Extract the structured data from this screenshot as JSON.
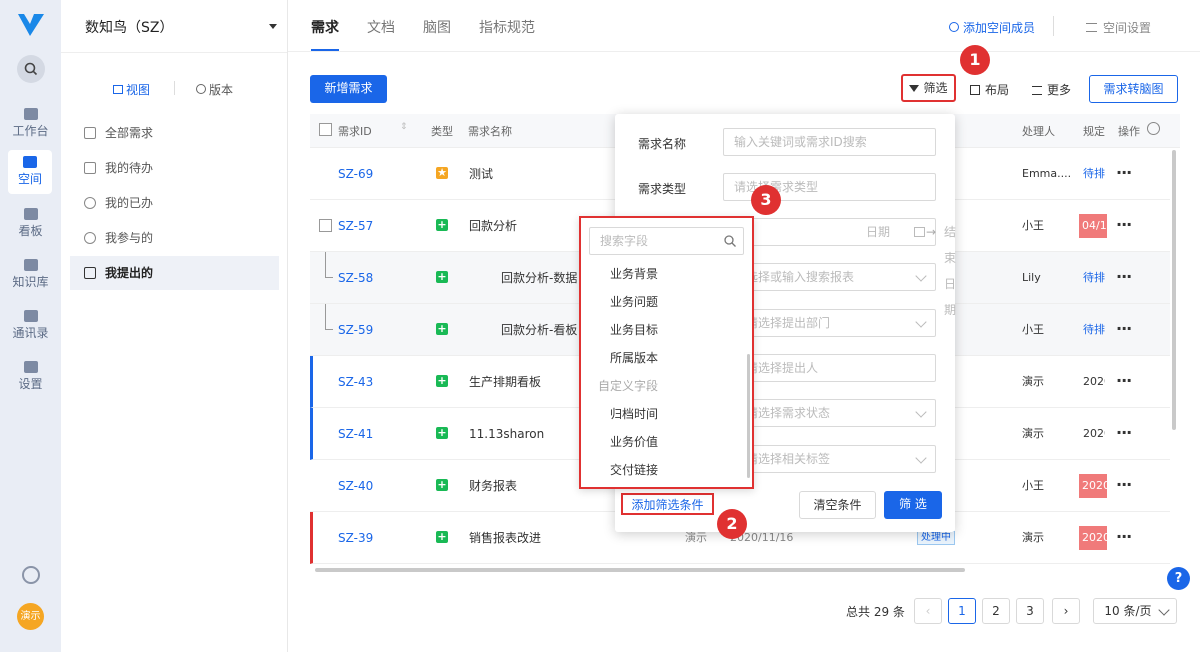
{
  "rail": {
    "items": [
      {
        "label": "工作台",
        "icon": "workspace-icon"
      },
      {
        "label": "空间",
        "icon": "cube-icon"
      },
      {
        "label": "看板",
        "icon": "board-icon"
      },
      {
        "label": "知识库",
        "icon": "book-icon"
      },
      {
        "label": "通讯录",
        "icon": "contacts-icon"
      },
      {
        "label": "设置",
        "icon": "gear-icon"
      }
    ],
    "avatar": "演示"
  },
  "side": {
    "workspace": "数知鸟（SZ）",
    "view_label": "视图",
    "version_label": "版本",
    "items": [
      "全部需求",
      "我的待办",
      "我的已办",
      "我参与的",
      "我提出的"
    ]
  },
  "header": {
    "tabs": [
      "需求",
      "文档",
      "脑图",
      "指标规范"
    ],
    "add_member": "添加空间成员",
    "settings": "空间设置"
  },
  "toolbar": {
    "new_button": "新增需求",
    "filter": "筛选",
    "layout": "布局",
    "more": "更多",
    "mindmap_button": "需求转脑图"
  },
  "table": {
    "headers": [
      "需求ID",
      "类型",
      "需求名称",
      "处理人",
      "规定",
      "操作"
    ],
    "rows": [
      {
        "id": "SZ-69",
        "name": "测试",
        "type": "star",
        "handler": "Emma....",
        "extra": "待排"
      },
      {
        "id": "SZ-57",
        "name": "回款分析",
        "type": "plus",
        "handler": "小王",
        "extra": "04/1"
      },
      {
        "id": "SZ-58",
        "name": "回款分析-数据",
        "type": "plus",
        "handler": "Lily",
        "extra": "待排"
      },
      {
        "id": "SZ-59",
        "name": "回款分析-看板",
        "type": "plus",
        "handler": "小王",
        "extra": "待排"
      },
      {
        "id": "SZ-43",
        "name": "生产排期看板",
        "type": "plus",
        "handler": "演示",
        "extra": "2020"
      },
      {
        "id": "SZ-41",
        "name": "11.13sharon",
        "type": "plus",
        "handler": "演示",
        "extra": "2020"
      },
      {
        "id": "SZ-40",
        "name": "财务报表",
        "type": "plus",
        "handler": "小王",
        "extra": "2020"
      },
      {
        "id": "SZ-39",
        "name": "销售报表改进",
        "type": "plus",
        "handler": "演示",
        "extra": "2020",
        "creator": "演示",
        "date": "2020/11/16",
        "status": "处理中"
      }
    ]
  },
  "pagination": {
    "total": "总共 29 条",
    "pages": [
      "1",
      "2",
      "3"
    ],
    "page_size": "10 条/页"
  },
  "filter": {
    "name_label": "需求名称",
    "name_placeholder": "输入关键词或需求ID搜索",
    "type_label": "需求类型",
    "type_placeholder": "请选择需求类型",
    "date_start": "日期",
    "date_end": "结束日期",
    "report_placeholder": "选择或输入搜索报表",
    "dept_placeholder": "请选择提出部门",
    "person_placeholder": "请选择提出人",
    "status_placeholder": "请选择需求状态",
    "tag_placeholder": "请选择相关标签",
    "add_condition": "添加筛选条件",
    "clear": "清空条件",
    "apply": "筛 选"
  },
  "fields": {
    "search_placeholder": "搜索字段",
    "items": [
      "业务背景",
      "业务问题",
      "业务目标",
      "所属版本"
    ],
    "group": "自定义字段",
    "custom_items": [
      "归档时间",
      "业务价值",
      "交付链接"
    ]
  },
  "badges": [
    "1",
    "2",
    "3"
  ],
  "colors": {
    "accent": "#1a66e8",
    "annotation": "#e03131",
    "success": "#19b955"
  }
}
